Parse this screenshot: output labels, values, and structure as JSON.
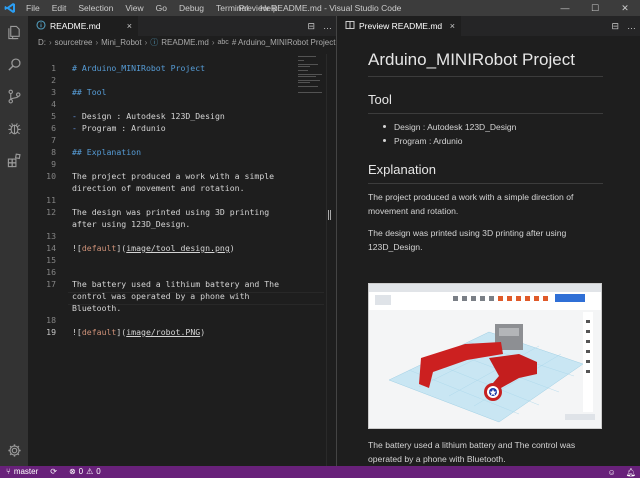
{
  "window": {
    "title": "Preview README.md - Visual Studio Code",
    "menu": [
      "File",
      "Edit",
      "Selection",
      "View",
      "Go",
      "Debug",
      "Terminal",
      "Help"
    ],
    "controls": {
      "minimize": "—",
      "maximize": "☐",
      "close": "✕"
    }
  },
  "activity_bar": {
    "icons": [
      "files-icon",
      "search-icon",
      "source-control-icon",
      "debug-icon",
      "extensions-icon",
      "settings-gear-icon"
    ]
  },
  "editor": {
    "tab_label": "README.md",
    "tab_close": "×",
    "actions": {
      "split": "⊟",
      "more": "…"
    },
    "breadcrumb": [
      "D:",
      "sourcetree",
      "Mini_Robot",
      "README.md",
      "# Arduino_MINIRobot Project"
    ],
    "lines": [
      {
        "n": "1",
        "t": "# Arduino_MINIRobot Project",
        "kind": "head"
      },
      {
        "n": "2",
        "t": "",
        "kind": "plain"
      },
      {
        "n": "3",
        "t": "## Tool",
        "kind": "head"
      },
      {
        "n": "4",
        "t": "",
        "kind": "plain"
      },
      {
        "n": "5",
        "t": "- Design : Autodesk 123D_Design",
        "kind": "list"
      },
      {
        "n": "6",
        "t": "- Program : Ardunio",
        "kind": "list"
      },
      {
        "n": "7",
        "t": "",
        "kind": "plain"
      },
      {
        "n": "8",
        "t": "## Explanation",
        "kind": "head"
      },
      {
        "n": "9",
        "t": "",
        "kind": "plain"
      },
      {
        "n": "10",
        "t": "The project produced a work with a simple",
        "kind": "plain"
      },
      {
        "n": "",
        "t": "direction of movement and rotation.",
        "kind": "plain"
      },
      {
        "n": "11",
        "t": "",
        "kind": "plain"
      },
      {
        "n": "12",
        "t": "The design was printed using 3D printing",
        "kind": "plain"
      },
      {
        "n": "",
        "t": "after using 123D_Design.",
        "kind": "plain"
      },
      {
        "n": "13",
        "t": "",
        "kind": "plain"
      },
      {
        "n": "14",
        "t": "![default](image/tool_design.png)",
        "kind": "link"
      },
      {
        "n": "15",
        "t": "",
        "kind": "plain"
      },
      {
        "n": "16",
        "t": "",
        "kind": "plain"
      },
      {
        "n": "17",
        "t": "The battery used a lithium battery and The",
        "kind": "plain"
      },
      {
        "n": "",
        "t": "control was operated by a phone with",
        "kind": "plain"
      },
      {
        "n": "",
        "t": "Bluetooth.",
        "kind": "plain"
      },
      {
        "n": "18",
        "t": "",
        "kind": "plain"
      },
      {
        "n": "19",
        "t": "![default](image/robot.PNG)",
        "kind": "link"
      }
    ],
    "active_line": "19"
  },
  "preview": {
    "tab_label": "Preview README.md",
    "tab_close": "×",
    "actions": {
      "split": "⊟",
      "more": "…"
    },
    "h1": "Arduino_MINIRobot Project",
    "tool_heading": "Tool",
    "tool_items": [
      "Design : Autodesk 123D_Design",
      "Program : Ardunio"
    ],
    "explanation_heading": "Explanation",
    "p1": "The project produced a work with a simple direction of movement and rotation.",
    "p2": "The design was printed using 3D printing after using 123D_Design.",
    "p3": "The battery used a lithium battery and The control was operated by a phone with Bluetooth."
  },
  "statusbar": {
    "branch": "master",
    "errors": "0",
    "warnings": "0",
    "sync_icon": "sync-icon",
    "feedback_icon": "smiley-icon",
    "notifications_icon": "bell-icon"
  },
  "colors": {
    "statusbar": "#68217a",
    "titlebar": "#3c3c3c",
    "activitybar": "#333333",
    "editor_bg": "#1e1e1e",
    "heading": "#569cd6"
  }
}
